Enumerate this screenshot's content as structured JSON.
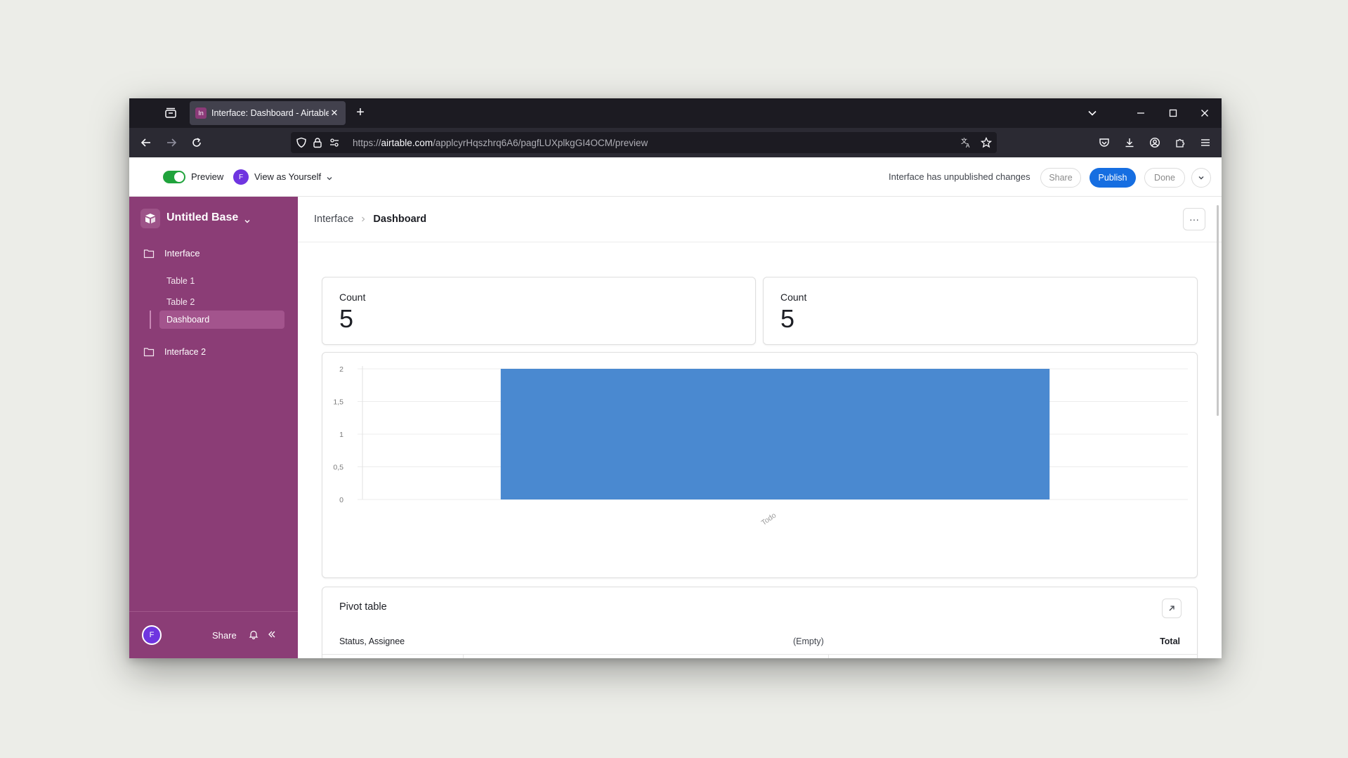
{
  "browser": {
    "tab_title": "Interface: Dashboard - Airtable",
    "tab_favicon": "In",
    "url_prefix": "https://",
    "url_host": "airtable.com",
    "url_path": "/applcyrHqszhrq6A6/pagfLUXplkgGI4OCM/preview"
  },
  "topbar": {
    "preview_label": "Preview",
    "preview_on": true,
    "view_as_avatar": "F",
    "view_as_label": "View as Yourself",
    "status_text": "Interface has unpublished changes",
    "share_label": "Share",
    "publish_label": "Publish",
    "done_label": "Done"
  },
  "sidebar": {
    "base_name": "Untitled Base",
    "folders": [
      {
        "label": "Interface",
        "pages": [
          "Table 1",
          "Table 2",
          "Dashboard"
        ]
      },
      {
        "label": "Interface 2",
        "pages": []
      }
    ],
    "active_page": "Dashboard",
    "footer": {
      "avatar": "F",
      "share_label": "Share"
    }
  },
  "main": {
    "breadcrumb": [
      "Interface",
      "Dashboard"
    ],
    "more_label": "···",
    "stats": [
      {
        "label": "Count",
        "value": "5"
      },
      {
        "label": "Count",
        "value": "5"
      }
    ],
    "pivot": {
      "title": "Pivot table",
      "columns": [
        "Status, Assignee",
        "(Empty)",
        "Total"
      ]
    }
  },
  "colors": {
    "sidebar_bg": "#8b3d76",
    "accent_blue": "#166ee1",
    "bar_color": "#4a89d0",
    "toggle_green": "#20a33c"
  },
  "chart_data": {
    "type": "bar",
    "categories": [
      "Todo"
    ],
    "values": [
      2
    ],
    "ylim": [
      0,
      2
    ],
    "yticks": [
      "0",
      "0,5",
      "1",
      "1,5",
      "2"
    ],
    "grid": true
  }
}
